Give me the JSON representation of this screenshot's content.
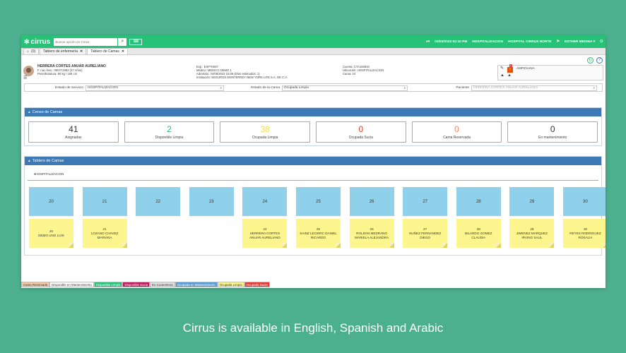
{
  "topbar": {
    "logo": "cirrus",
    "search_placeholder": "Buscar opción en Cirrus",
    "datetime": "03/03/2023 02:10 PM",
    "area": "HOSPITALIZACION",
    "hospital": "HOSPITAL CIRRUS NORTE",
    "user": "ESTHER MEDINA ▾"
  },
  "tabs": [
    {
      "label": "(0)"
    },
    {
      "label": "Tablero de enfermería"
    },
    {
      "label": "Tablero de Camas"
    }
  ],
  "patient": {
    "name": "HERRERA CORTES ANUAR AURELIANO",
    "birth": "F. nac./sex.: 09/07/1983 (37 Años)",
    "weight": "Peso/Estatura: 80 kg / 165 cm",
    "exp": "Exp.: EXP70007",
    "medico": "Médico: MEDICO DEMO 1",
    "admision": "Admisión: 04/06/2023 15:05 (Días estimados: 1)",
    "institucion": "Institución: SEGUROS MONTERREY NEW YORK LIFE S.A. DE C.V.",
    "cuenta": "Cuenta: CTA184934",
    "ubicacion": "Ubicación: HOSPITALIZACION",
    "cama": "Cama: 24",
    "alert": "AMPICILINA",
    "badge": "1"
  },
  "filters": {
    "estado_servicio_label": "Estado de Servicio",
    "estado_servicio_value": "HOSPITALIZACION",
    "estado_cama_label": "Estado de la Cama",
    "estado_cama_value": "Ocupada Limpia",
    "paciente_label": "Paciente",
    "paciente_value": "HERRERA CORTES ANUAR AURELIANO"
  },
  "censo": {
    "title": "Censo de Camas",
    "stats": [
      {
        "value": "41",
        "label": "Asignadas",
        "color": "#333333"
      },
      {
        "value": "2",
        "label": "Disponible Limpia",
        "color": "#27c178"
      },
      {
        "value": "38",
        "label": "Ocupada Limpia",
        "color": "#f2e04a"
      },
      {
        "value": "0",
        "label": "Ocupada Sucia",
        "color": "#e53935"
      },
      {
        "value": "0",
        "label": "Cama Reservada",
        "color": "#f08a6b"
      },
      {
        "value": "0",
        "label": "En mantenimiento",
        "color": "#333333"
      }
    ]
  },
  "tablero": {
    "title": "Tablero de Camas",
    "group": "▾HOSPITALIZACION",
    "beds": [
      {
        "num": "20",
        "label": "20",
        "patient": "DEMO UNO LUIS",
        "occupied": true
      },
      {
        "num": "21",
        "label": "21",
        "patient": "LOZANO CHAVEZ MARIANA",
        "occupied": true
      },
      {
        "num": "22",
        "label": "",
        "patient": "",
        "occupied": false
      },
      {
        "num": "23",
        "label": "",
        "patient": "",
        "occupied": false
      },
      {
        "num": "24",
        "label": "24",
        "patient": "HERRERA CORTES ANUAR AURELIANO",
        "occupied": true
      },
      {
        "num": "25",
        "label": "25",
        "patient": "SAINZ LECIERC DANIEL RICARDO",
        "occupied": true
      },
      {
        "num": "26",
        "label": "26",
        "patient": "ROLDAN MEDRANO MARIELA ALEJANDRA",
        "occupied": true
      },
      {
        "num": "27",
        "label": "27",
        "patient": "NUÑEZ FERNANDEZ DIEGO",
        "occupied": true
      },
      {
        "num": "28",
        "label": "28",
        "patient": "BILARDO GOMEZ CLAUDIA",
        "occupied": true
      },
      {
        "num": "29",
        "label": "29",
        "patient": "JIMENEZ MARQUEZ IRVING SAUL",
        "occupied": true
      },
      {
        "num": "30",
        "label": "30",
        "patient": "REYES RODRIGUEZ ROSALIA",
        "occupied": true
      }
    ]
  },
  "legend": [
    {
      "label": "Cama Reservada",
      "bg": "#f4c9a8",
      "fg": "#333333"
    },
    {
      "label": "Disponible en Mantenimiento",
      "bg": "#ffffff",
      "fg": "#333333"
    },
    {
      "label": "Disponible Limpia",
      "bg": "#27c178",
      "fg": "#ffffff"
    },
    {
      "label": "Disponible Sucia",
      "bg": "#c2185b",
      "fg": "#ffffff"
    },
    {
      "label": "En Cuarentena",
      "bg": "#e0e0e0",
      "fg": "#333333"
    },
    {
      "label": "Ocupada en Mantenimiento",
      "bg": "#5b9bd5",
      "fg": "#ffffff"
    },
    {
      "label": "Ocupada Limpia",
      "bg": "#fdf68e",
      "fg": "#333333"
    },
    {
      "label": "Ocupada Sucia",
      "bg": "#e53935",
      "fg": "#ffffff"
    }
  ],
  "caption": "Cirrus is available in English, Spanish and Arabic"
}
